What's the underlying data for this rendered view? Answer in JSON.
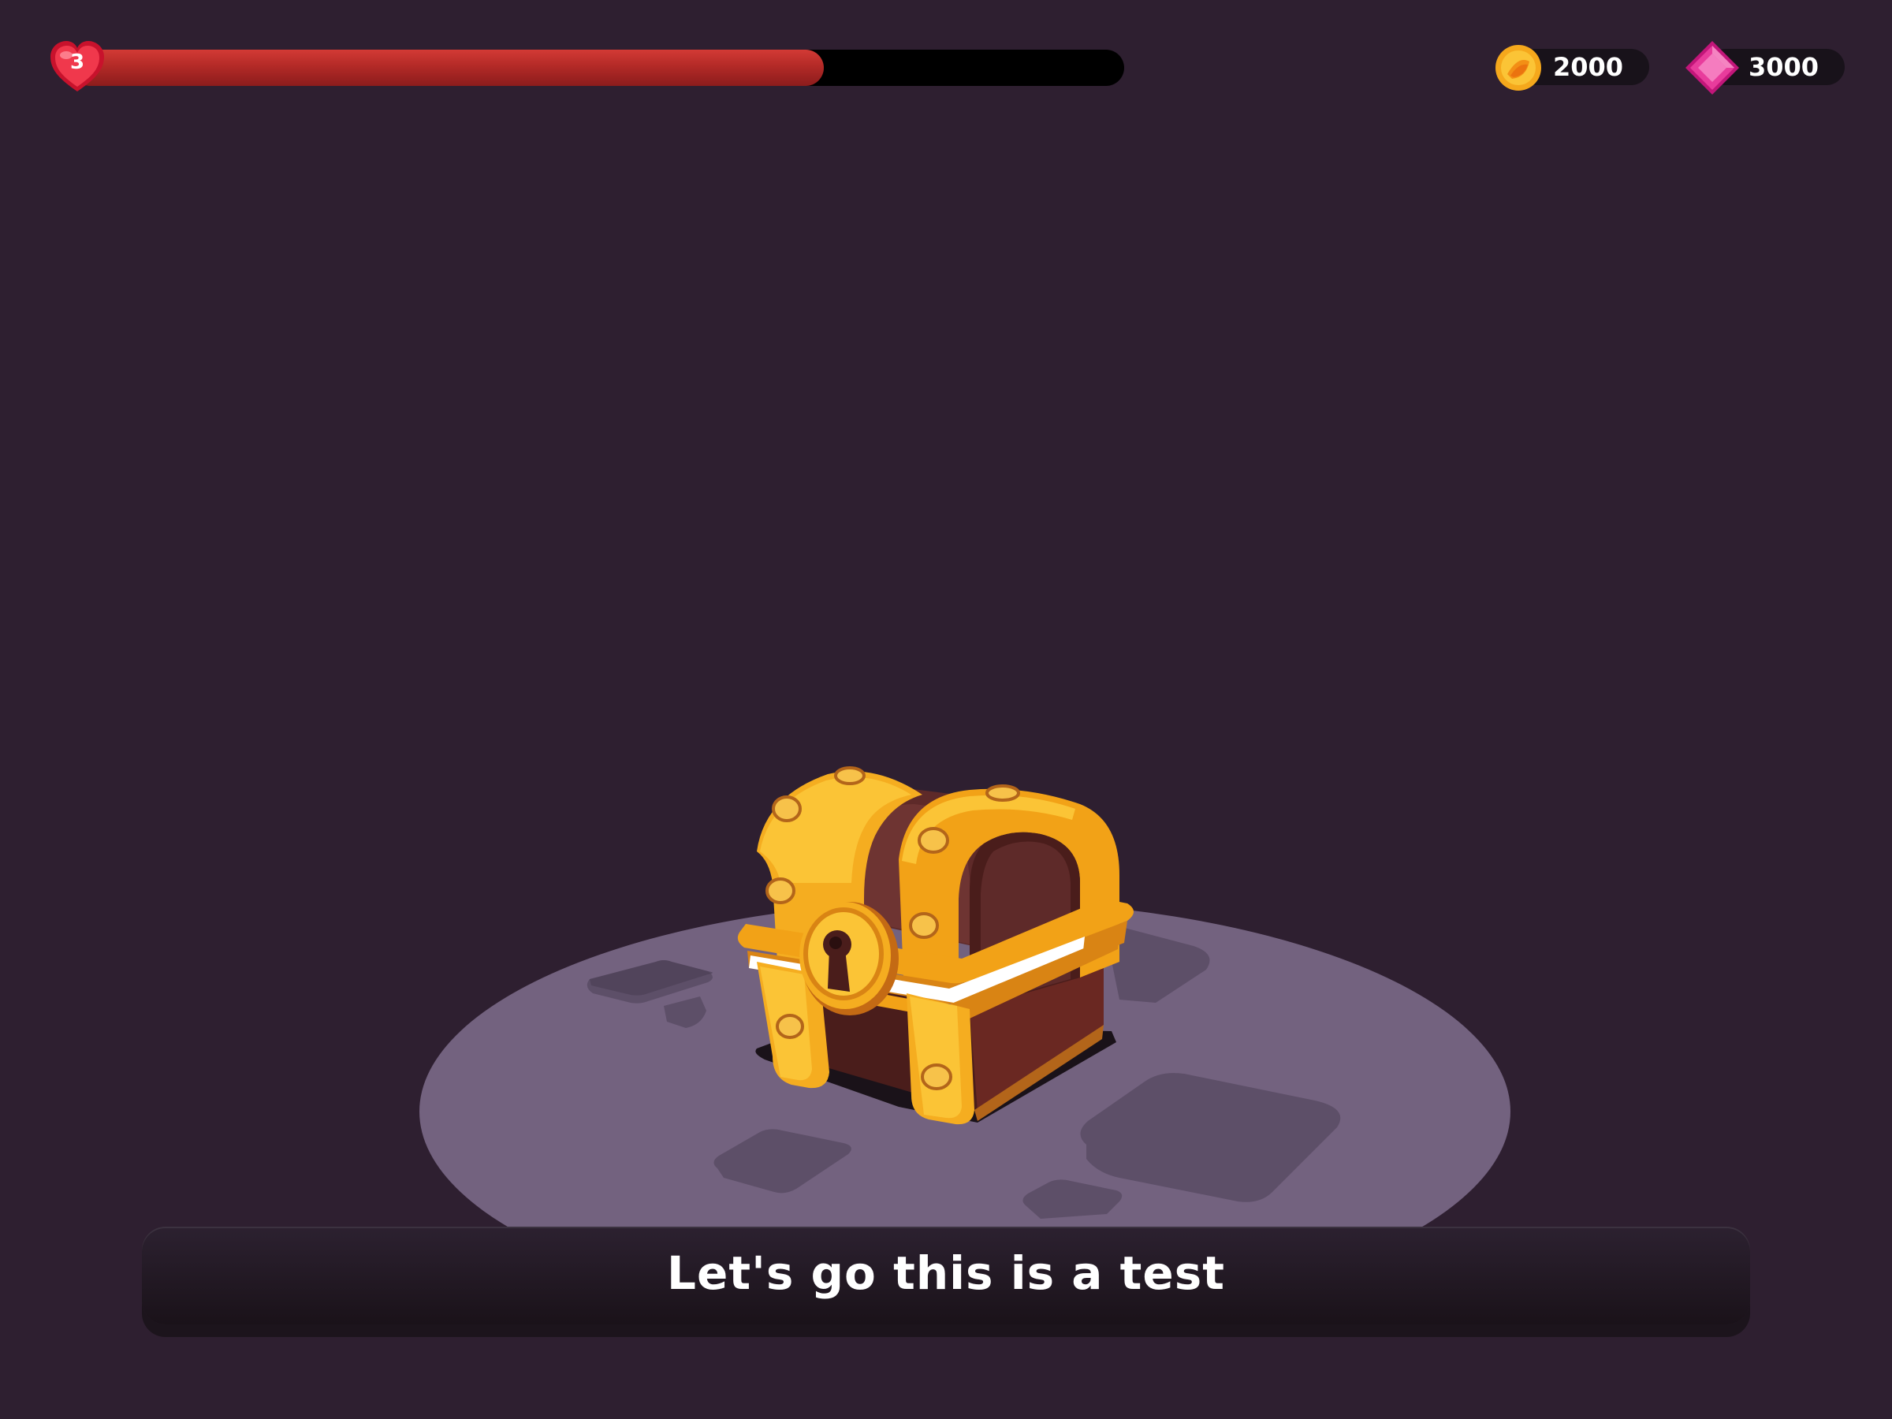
{
  "hud": {
    "lives": "3",
    "health_fraction": 0.715,
    "coins": "2000",
    "gems": "3000"
  },
  "icons": {
    "lives": "heart-icon",
    "coins": "coin-icon",
    "gems": "gem-icon",
    "scene": "treasure-chest"
  },
  "dialog": {
    "text": "Let's go this is a test"
  },
  "colors": {
    "background": "#2e1f30",
    "health": "#b32a27",
    "platform": "#73627f",
    "gold": "#f5a81c",
    "gem": "#e83c9c"
  }
}
